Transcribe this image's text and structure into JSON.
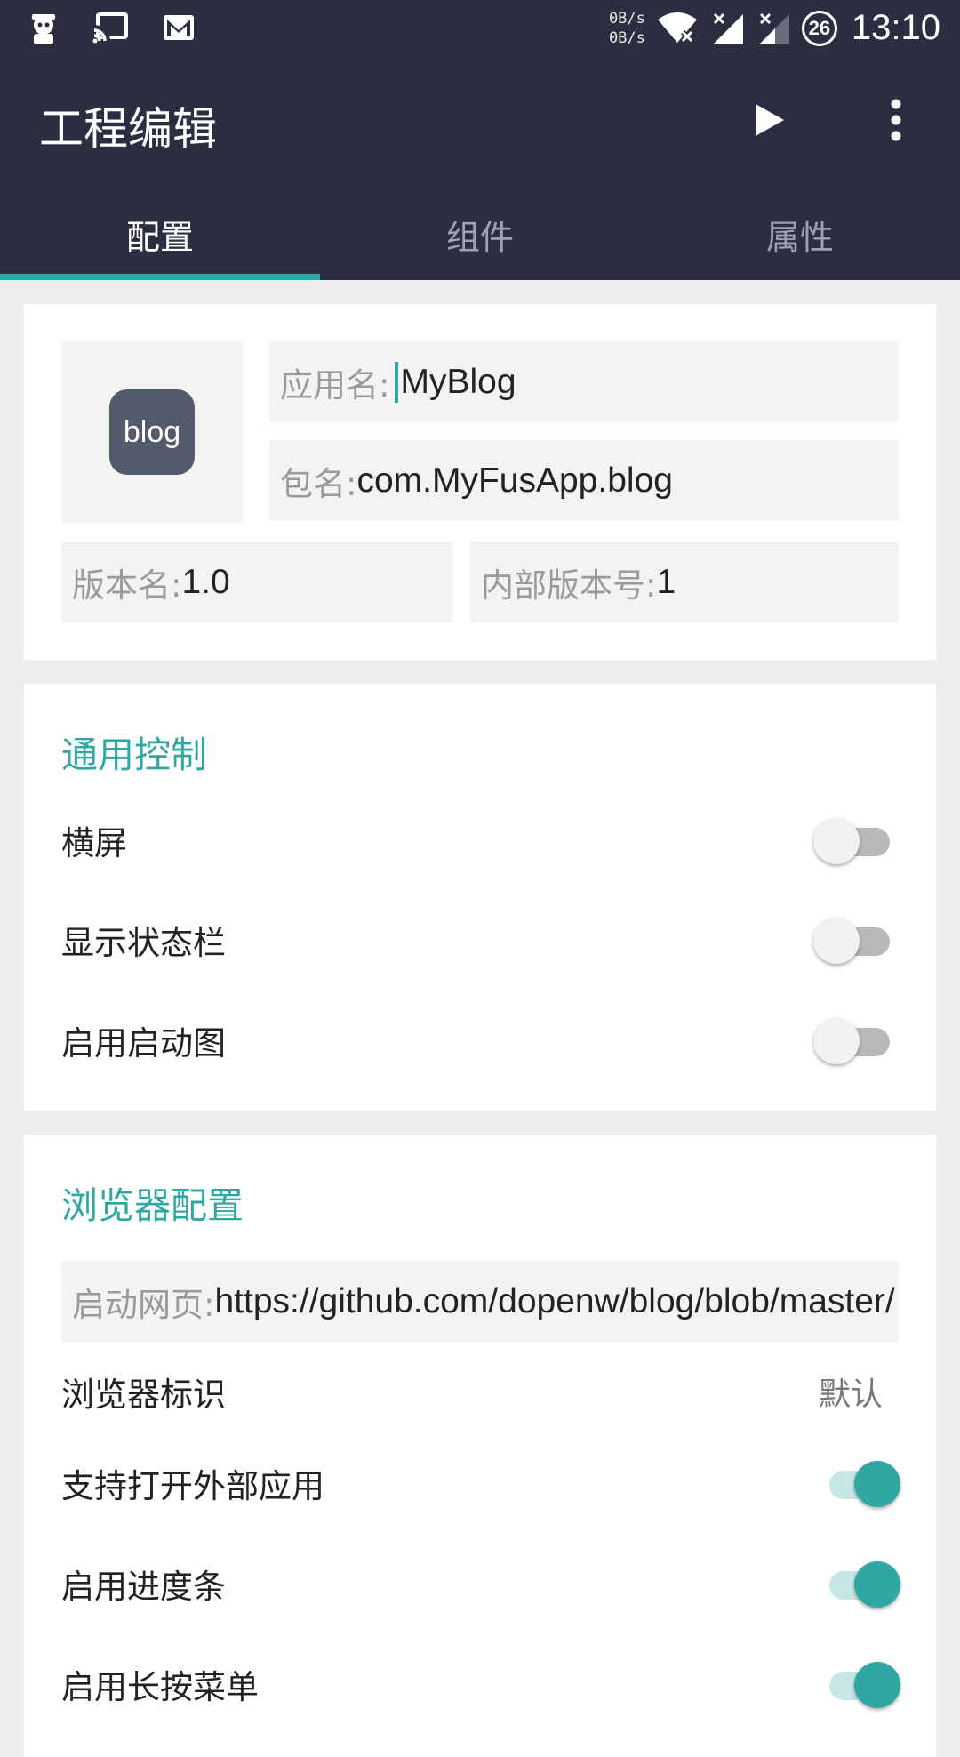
{
  "status_bar": {
    "net_speed_up": "0B/s",
    "net_speed_down": "0B/s",
    "badge": "26",
    "time": "13:10"
  },
  "app_bar": {
    "title": "工程编辑"
  },
  "tabs": [
    {
      "label": "配置",
      "active": true
    },
    {
      "label": "组件",
      "active": false
    },
    {
      "label": "属性",
      "active": false
    }
  ],
  "project": {
    "icon_text": "blog",
    "app_name_label": "应用名: ",
    "app_name_value": "MyBlog",
    "package_label": "包名: ",
    "package_value": "com.MyFusApp.blog",
    "version_name_label": "版本名: ",
    "version_name_value": "1.0",
    "version_code_label": "内部版本号: ",
    "version_code_value": "1"
  },
  "general": {
    "title": "通用控制",
    "items": [
      {
        "label": "横屏",
        "on": false
      },
      {
        "label": "显示状态栏",
        "on": false
      },
      {
        "label": "启用启动图",
        "on": false
      }
    ]
  },
  "browser": {
    "title": "浏览器配置",
    "start_page_label": "启动网页: ",
    "start_page_value": "https://github.com/dopenw/blog/blob/master/",
    "ua_label": "浏览器标识",
    "ua_value": "默认",
    "items": [
      {
        "label": "支持打开外部应用",
        "on": true
      },
      {
        "label": "启用进度条",
        "on": true
      },
      {
        "label": "启用长按菜单",
        "on": true
      }
    ]
  },
  "colors": {
    "bar": "#2b2d40",
    "accent": "#30a7a3",
    "background": "#eeeeee"
  }
}
